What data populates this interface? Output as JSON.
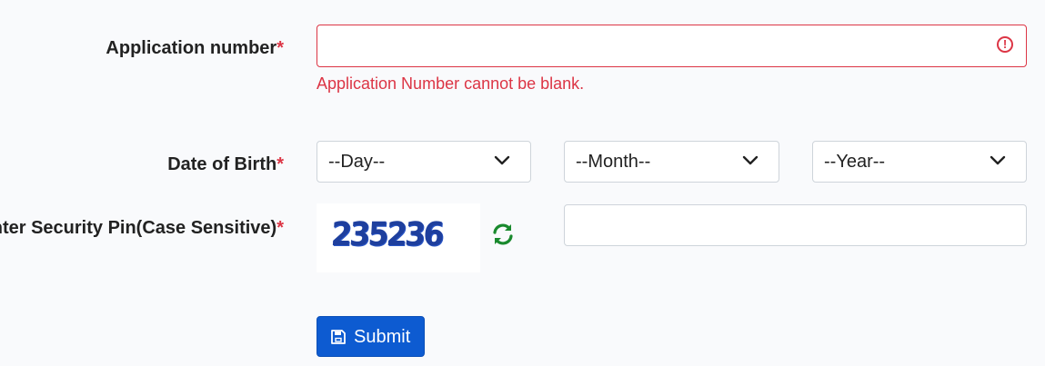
{
  "form": {
    "application_number": {
      "label": "Application number",
      "required_mark": "*",
      "value": "",
      "error": "Application Number cannot be blank."
    },
    "date_of_birth": {
      "label": "Date of Birth",
      "required_mark": "*",
      "day_placeholder": "--Day--",
      "month_placeholder": "--Month--",
      "year_placeholder": "--Year--"
    },
    "security_pin": {
      "label": "nter Security Pin(Case Sensitive)",
      "required_mark": "*",
      "captcha_text": "235236",
      "value": ""
    },
    "submit_label": "Submit"
  },
  "icons": {
    "error": "exclamation-circle-icon",
    "dropdown": "chevron-down-icon",
    "refresh": "refresh-icon",
    "submit": "save-icon"
  },
  "colors": {
    "error": "#dc3545",
    "primary": "#0d5bd1",
    "refresh": "#1a8a2e",
    "captcha": "#1e3f9e"
  }
}
